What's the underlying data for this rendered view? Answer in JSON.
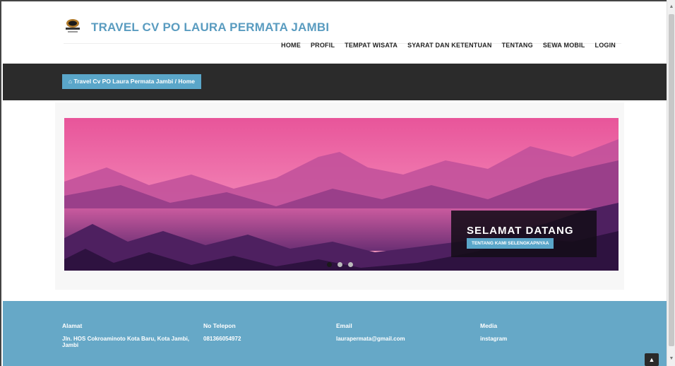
{
  "header": {
    "brand": "TRAVEL CV PO LAURA PERMATA JAMBI",
    "nav": [
      "HOME",
      "PROFIL",
      "TEMPAT WISATA",
      "SYARAT DAN KETENTUAN",
      "TENTANG",
      "SEWA MOBIL",
      "LOGIN"
    ]
  },
  "breadcrumb": "⌂ Travel Cv PO Laura Permata Jambi / Home",
  "slider": {
    "title": "SELAMAT DATANG",
    "button": "TENTANG KAMI SELENGKAPNYAA",
    "active_slide": 1,
    "total_slides": 3
  },
  "footer": {
    "alamat_label": "Alamat",
    "alamat_value": "Jln. HOS Cokroaminoto Kota Baru, Kota Jambi, Jambi",
    "telepon_label": "No Telepon",
    "telepon_value": "081366054972",
    "email_label": "Email",
    "email_value": "laurapermata@gmail.com",
    "media_label": "Media",
    "media_value": "instagram"
  },
  "colors": {
    "accent": "#5aa6c9",
    "brand": "#5a9cc0",
    "dark": "#2b2b2b",
    "footer": "#66a8c7"
  },
  "icons": {
    "home": "home-icon",
    "to_top": "chevron-up-icon"
  }
}
